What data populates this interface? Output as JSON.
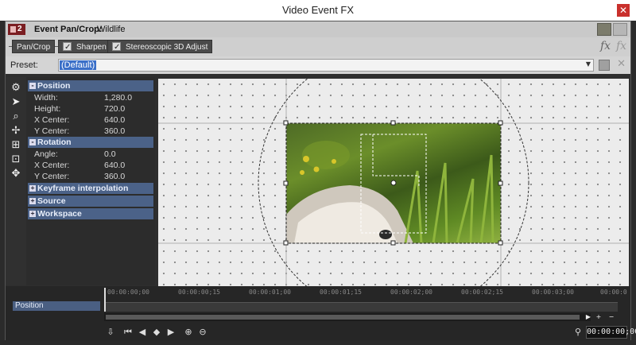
{
  "window": {
    "title": "Video Event FX",
    "close_icon": "close-icon"
  },
  "header": {
    "badge": "2",
    "label": "Event Pan/Crop:",
    "event_name": "Wildlife"
  },
  "chain": {
    "plugins": [
      {
        "label": "Pan/Crop"
      },
      {
        "label": "Sharpen",
        "checked": true
      },
      {
        "label": "Stereoscopic 3D Adjust",
        "checked": true
      }
    ],
    "fx_icon": "fx",
    "fx_remove_icon": "fx"
  },
  "preset": {
    "label": "Preset:",
    "value": "(Default)"
  },
  "properties": {
    "position": {
      "title": "Position",
      "rows": [
        {
          "key": "Width:",
          "value": "1,280.0"
        },
        {
          "key": "Height:",
          "value": "720.0"
        },
        {
          "key": "X Center:",
          "value": "640.0"
        },
        {
          "key": "Y Center:",
          "value": "360.0"
        }
      ]
    },
    "rotation": {
      "title": "Rotation",
      "rows": [
        {
          "key": "Angle:",
          "value": "0.0"
        },
        {
          "key": "X Center:",
          "value": "640.0"
        },
        {
          "key": "Y Center:",
          "value": "360.0"
        }
      ]
    },
    "collapsed": [
      "Keyframe interpolation",
      "Source",
      "Workspace"
    ]
  },
  "timeline": {
    "track": "Position",
    "ruler": [
      "00:00:00;00",
      "00:00:00;15",
      "00:00:01;00",
      "00:00:01;15",
      "00:00:02;00",
      "00:00:02;15",
      "00:00:03;00",
      "00:00:0"
    ],
    "time": "00:00:00;00"
  }
}
